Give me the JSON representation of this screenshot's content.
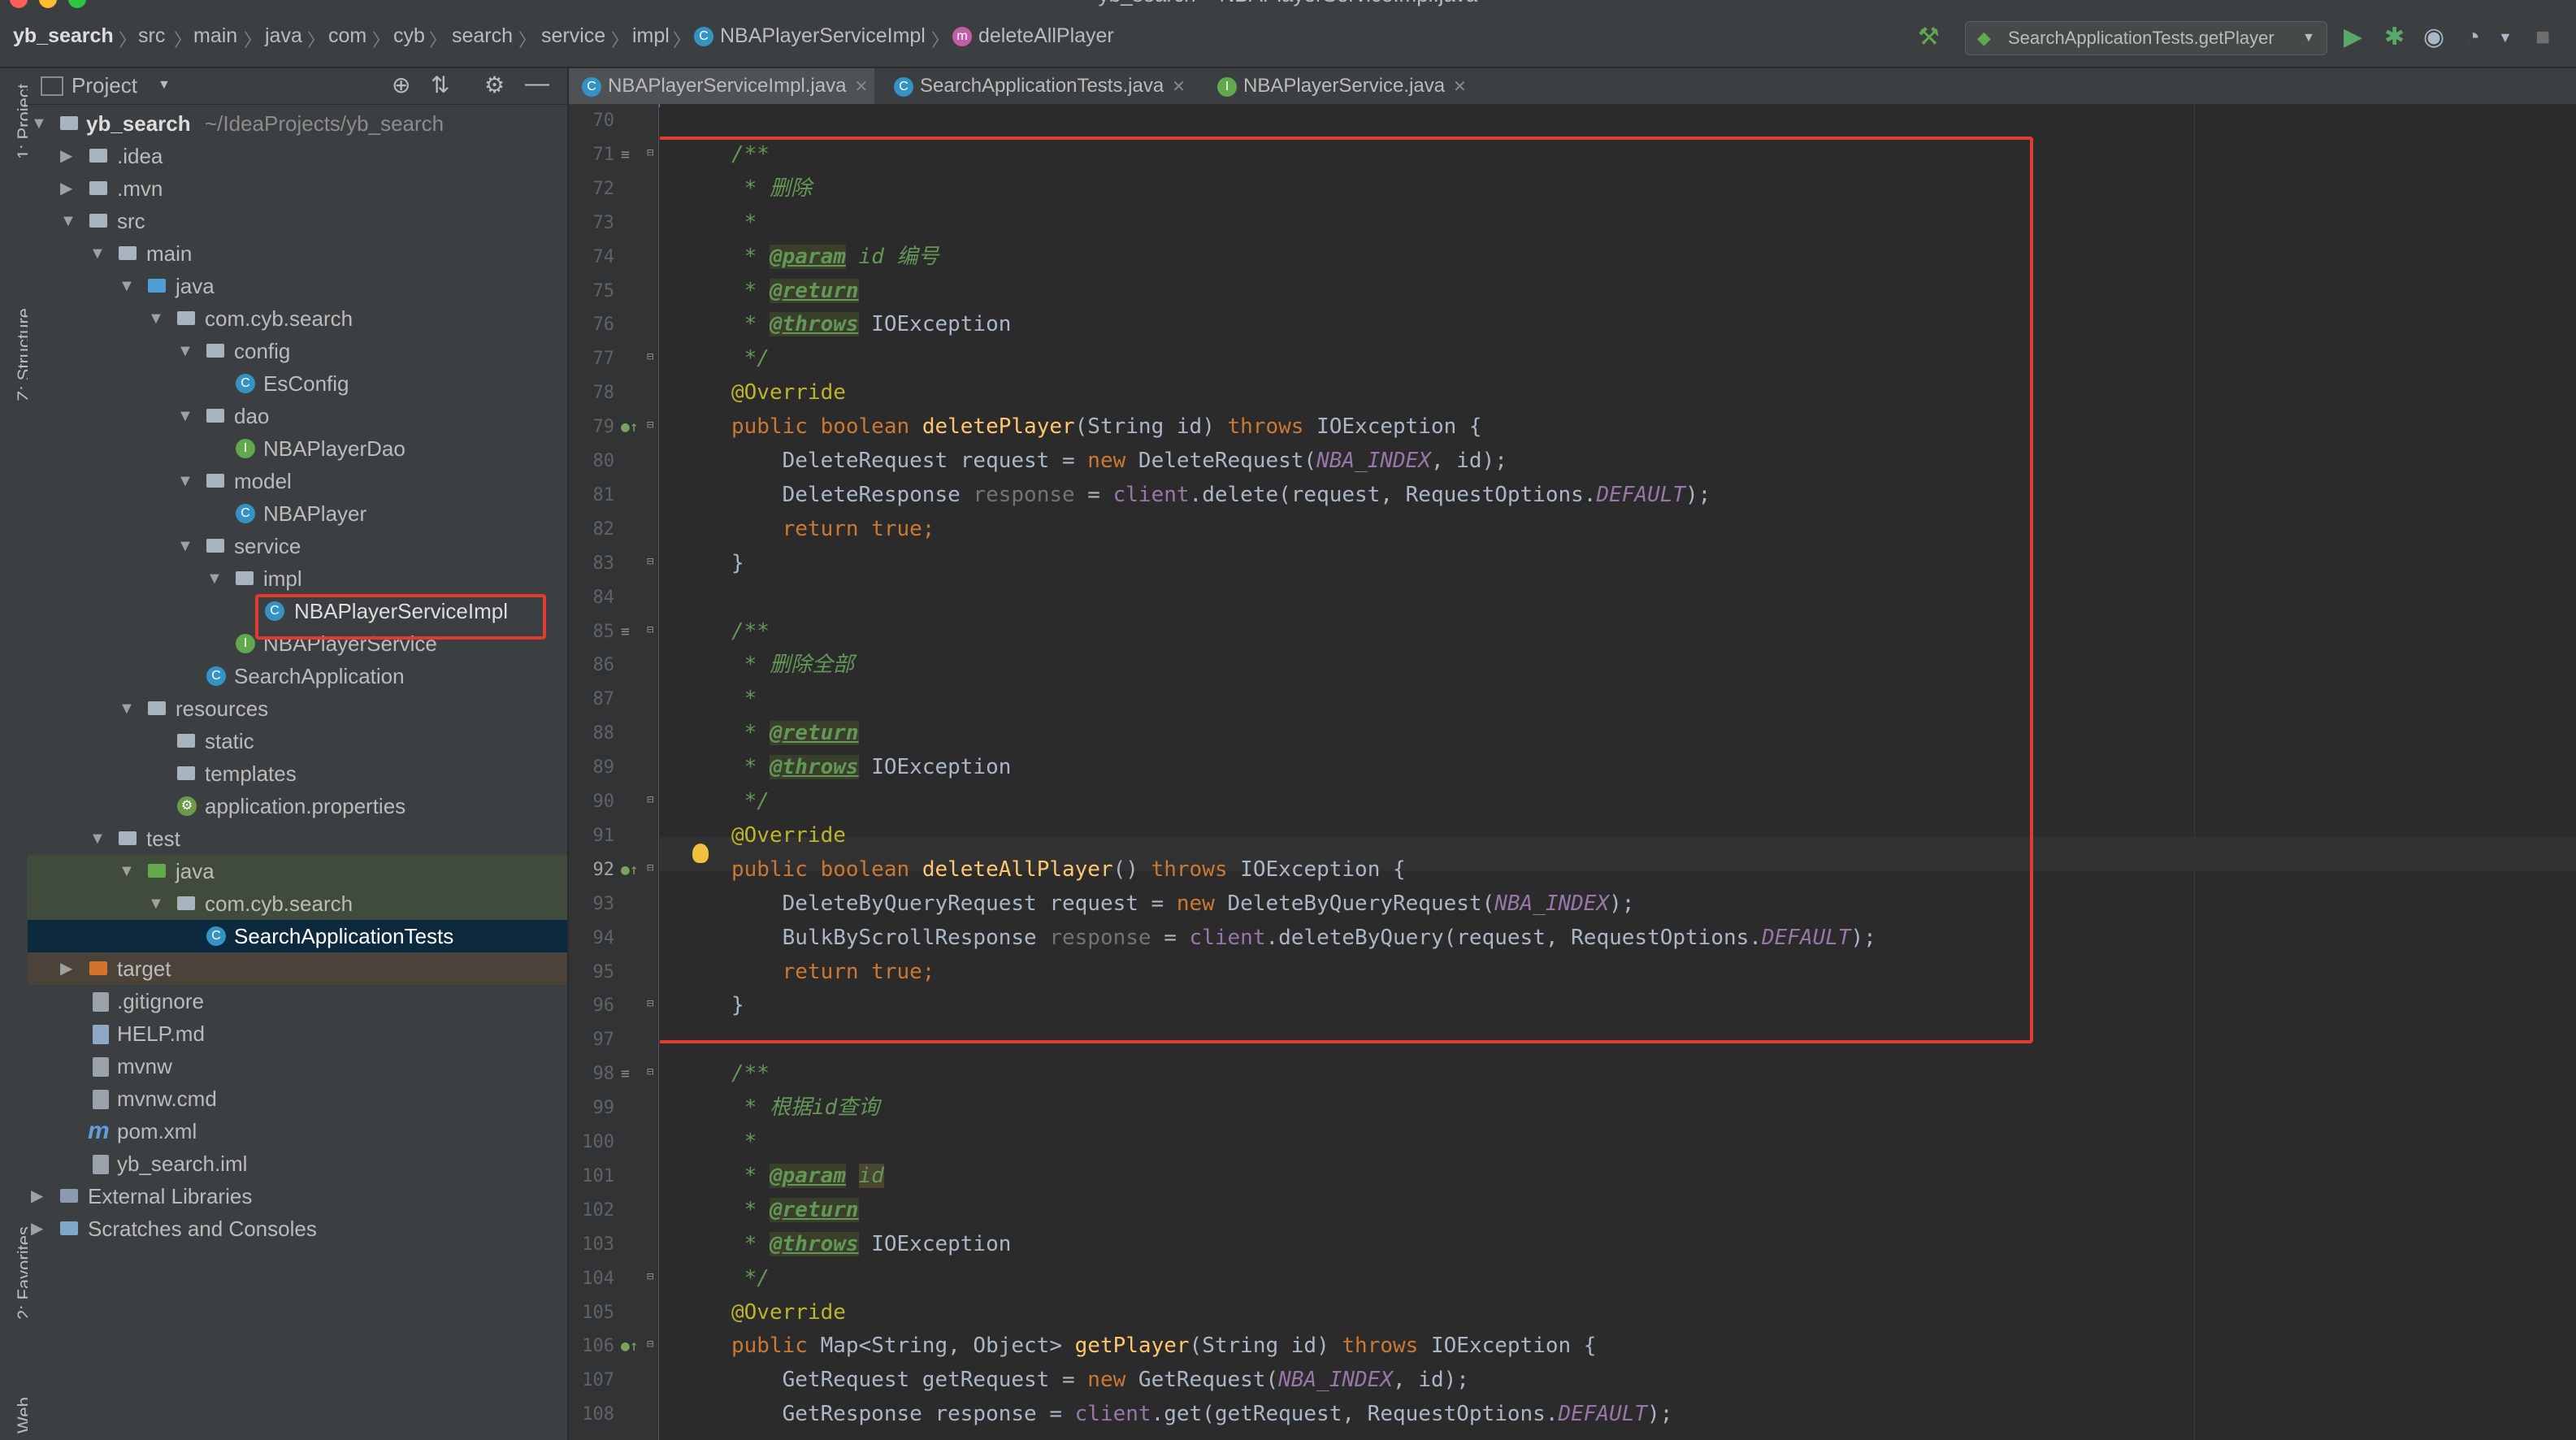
{
  "window_title": "yb_search – NBAPlayerServiceImpl.java",
  "navbar": {
    "project": "yb_search",
    "crumbs": [
      "src",
      "main",
      "java",
      "com",
      "cyb",
      "search",
      "service",
      "impl"
    ],
    "class_name": "NBAPlayerServiceImpl",
    "method_name": "deleteAllPlayer",
    "run_config": "SearchApplicationTests.getPlayer"
  },
  "sidebar_labels": {
    "project": "1: Project",
    "structure": "Z: Structure",
    "favorites": "2: Favorites",
    "web": "Web"
  },
  "project_panel": {
    "title": "Project",
    "tree": [
      {
        "label": "yb_search",
        "note": "~/IdeaProjects/yb_search"
      },
      {
        "label": ".idea"
      },
      {
        "label": ".mvn"
      },
      {
        "label": "src"
      },
      {
        "label": "main"
      },
      {
        "label": "java"
      },
      {
        "label": "com.cyb.search"
      },
      {
        "label": "config"
      },
      {
        "label": "EsConfig"
      },
      {
        "label": "dao"
      },
      {
        "label": "NBAPlayerDao"
      },
      {
        "label": "model"
      },
      {
        "label": "NBAPlayer"
      },
      {
        "label": "service"
      },
      {
        "label": "impl"
      },
      {
        "label": "NBAPlayerServiceImpl"
      },
      {
        "label": "NBAPlayerService"
      },
      {
        "label": "SearchApplication"
      },
      {
        "label": "resources"
      },
      {
        "label": "static"
      },
      {
        "label": "templates"
      },
      {
        "label": "application.properties"
      },
      {
        "label": "test"
      },
      {
        "label": "java"
      },
      {
        "label": "com.cyb.search"
      },
      {
        "label": "SearchApplicationTests"
      },
      {
        "label": "target"
      },
      {
        "label": ".gitignore"
      },
      {
        "label": "HELP.md"
      },
      {
        "label": "mvnw"
      },
      {
        "label": "mvnw.cmd"
      },
      {
        "label": "pom.xml"
      },
      {
        "label": "yb_search.iml"
      },
      {
        "label": "External Libraries"
      },
      {
        "label": "Scratches and Consoles"
      }
    ]
  },
  "tabs": [
    {
      "label": "NBAPlayerServiceImpl.java"
    },
    {
      "label": "SearchApplicationTests.java"
    },
    {
      "label": "NBAPlayerService.java"
    }
  ],
  "editor": {
    "current_line": "92",
    "lines": [
      {
        "n": "70"
      },
      {
        "n": "71",
        "parts": [
          {
            "t": "/**",
            "c": "cm"
          }
        ]
      },
      {
        "n": "72",
        "parts": [
          {
            "t": " * 删除",
            "c": "cm"
          }
        ]
      },
      {
        "n": "73",
        "parts": [
          {
            "t": " *",
            "c": "cm"
          }
        ]
      },
      {
        "n": "74",
        "parts": [
          {
            "t": " * ",
            "c": "cm"
          },
          {
            "t": "@param",
            "c": "tag"
          },
          {
            "t": " id 编号",
            "c": "cm"
          }
        ]
      },
      {
        "n": "75",
        "parts": [
          {
            "t": " * ",
            "c": "cm"
          },
          {
            "t": "@return",
            "c": "tag"
          }
        ]
      },
      {
        "n": "76",
        "parts": [
          {
            "t": " * ",
            "c": "cm"
          },
          {
            "t": "@throws",
            "c": "tag"
          },
          {
            "t": " IOException",
            "c": "plain"
          }
        ]
      },
      {
        "n": "77",
        "parts": [
          {
            "t": " */",
            "c": "cm"
          }
        ]
      },
      {
        "n": "78",
        "parts": [
          {
            "t": "@Override",
            "c": "ann"
          }
        ]
      },
      {
        "n": "79",
        "parts": [
          {
            "t": "public boolean ",
            "c": "kw"
          },
          {
            "t": "deletePlayer",
            "c": "fn"
          },
          {
            "t": "(String id) ",
            "c": "plain"
          },
          {
            "t": "throws ",
            "c": "kw"
          },
          {
            "t": "IOException {",
            "c": "plain"
          }
        ]
      },
      {
        "n": "80",
        "parts": [
          {
            "t": "    DeleteRequest request = ",
            "c": "plain"
          },
          {
            "t": "new ",
            "c": "kw"
          },
          {
            "t": "DeleteRequest(",
            "c": "plain"
          },
          {
            "t": "NBA_INDEX",
            "c": "cst"
          },
          {
            "t": ", id);",
            "c": "plain"
          }
        ]
      },
      {
        "n": "81",
        "parts": [
          {
            "t": "    DeleteResponse ",
            "c": "plain"
          },
          {
            "t": "response",
            "c": "unused"
          },
          {
            "t": " = ",
            "c": "plain"
          },
          {
            "t": "client",
            "c": "fld"
          },
          {
            "t": ".delete(request, RequestOptions.",
            "c": "plain"
          },
          {
            "t": "DEFAULT",
            "c": "cst"
          },
          {
            "t": ");",
            "c": "plain"
          }
        ]
      },
      {
        "n": "82",
        "parts": [
          {
            "t": "    return true;",
            "c": "kw"
          }
        ]
      },
      {
        "n": "83",
        "parts": [
          {
            "t": "}",
            "c": "plain"
          }
        ]
      },
      {
        "n": "84"
      },
      {
        "n": "85",
        "parts": [
          {
            "t": "/**",
            "c": "cm"
          }
        ]
      },
      {
        "n": "86",
        "parts": [
          {
            "t": " * 删除全部",
            "c": "cm"
          }
        ]
      },
      {
        "n": "87",
        "parts": [
          {
            "t": " *",
            "c": "cm"
          }
        ]
      },
      {
        "n": "88",
        "parts": [
          {
            "t": " * ",
            "c": "cm"
          },
          {
            "t": "@return",
            "c": "tag"
          }
        ]
      },
      {
        "n": "89",
        "parts": [
          {
            "t": " * ",
            "c": "cm"
          },
          {
            "t": "@throws",
            "c": "tag"
          },
          {
            "t": " IOException",
            "c": "plain"
          }
        ]
      },
      {
        "n": "90",
        "parts": [
          {
            "t": " */",
            "c": "cm"
          }
        ]
      },
      {
        "n": "91",
        "parts": [
          {
            "t": "@Override",
            "c": "ann"
          }
        ]
      },
      {
        "n": "92",
        "parts": [
          {
            "t": "public boolean ",
            "c": "kw"
          },
          {
            "t": "deleteAllPlayer",
            "c": "fn"
          },
          {
            "t": "() ",
            "c": "plain"
          },
          {
            "t": "throws ",
            "c": "kw"
          },
          {
            "t": "IOException {",
            "c": "plain"
          }
        ]
      },
      {
        "n": "93",
        "parts": [
          {
            "t": "    DeleteByQueryRequest request = ",
            "c": "plain"
          },
          {
            "t": "new ",
            "c": "kw"
          },
          {
            "t": "DeleteByQueryRequest(",
            "c": "plain"
          },
          {
            "t": "NBA_INDEX",
            "c": "cst"
          },
          {
            "t": ");",
            "c": "plain"
          }
        ]
      },
      {
        "n": "94",
        "parts": [
          {
            "t": "    BulkByScrollResponse ",
            "c": "plain"
          },
          {
            "t": "response",
            "c": "unused"
          },
          {
            "t": " = ",
            "c": "plain"
          },
          {
            "t": "client",
            "c": "fld"
          },
          {
            "t": ".deleteByQuery(request, RequestOptions.",
            "c": "plain"
          },
          {
            "t": "DEFAULT",
            "c": "cst"
          },
          {
            "t": ");",
            "c": "plain"
          }
        ]
      },
      {
        "n": "95",
        "parts": [
          {
            "t": "    return true;",
            "c": "kw"
          }
        ]
      },
      {
        "n": "96",
        "parts": [
          {
            "t": "}",
            "c": "plain"
          }
        ]
      },
      {
        "n": "97"
      },
      {
        "n": "98",
        "parts": [
          {
            "t": "/**",
            "c": "cm"
          }
        ]
      },
      {
        "n": "99",
        "parts": [
          {
            "t": " * 根据id查询",
            "c": "cm"
          }
        ]
      },
      {
        "n": "100",
        "parts": [
          {
            "t": " *",
            "c": "cm"
          }
        ]
      },
      {
        "n": "101",
        "parts": [
          {
            "t": " * ",
            "c": "cm"
          },
          {
            "t": "@param",
            "c": "tag"
          },
          {
            "t": " ",
            "c": "cm"
          },
          {
            "t": "id",
            "c": "idhl"
          }
        ]
      },
      {
        "n": "102",
        "parts": [
          {
            "t": " * ",
            "c": "cm"
          },
          {
            "t": "@return",
            "c": "tag"
          }
        ]
      },
      {
        "n": "103",
        "parts": [
          {
            "t": " * ",
            "c": "cm"
          },
          {
            "t": "@throws",
            "c": "tag"
          },
          {
            "t": " IOException",
            "c": "plain"
          }
        ]
      },
      {
        "n": "104",
        "parts": [
          {
            "t": " */",
            "c": "cm"
          }
        ]
      },
      {
        "n": "105",
        "parts": [
          {
            "t": "@Override",
            "c": "ann"
          }
        ]
      },
      {
        "n": "106",
        "parts": [
          {
            "t": "public ",
            "c": "kw"
          },
          {
            "t": "Map<String, Object> ",
            "c": "plain"
          },
          {
            "t": "getPlayer",
            "c": "fn"
          },
          {
            "t": "(String id) ",
            "c": "plain"
          },
          {
            "t": "throws ",
            "c": "kw"
          },
          {
            "t": "IOException {",
            "c": "plain"
          }
        ]
      },
      {
        "n": "107",
        "parts": [
          {
            "t": "    GetRequest getRequest = ",
            "c": "plain"
          },
          {
            "t": "new ",
            "c": "kw"
          },
          {
            "t": "GetRequest(",
            "c": "plain"
          },
          {
            "t": "NBA_INDEX",
            "c": "cst"
          },
          {
            "t": ", id);",
            "c": "plain"
          }
        ]
      },
      {
        "n": "108",
        "parts": [
          {
            "t": "    GetResponse response = ",
            "c": "plain"
          },
          {
            "t": "client",
            "c": "fld"
          },
          {
            "t": ".get(getRequest, RequestOptions.",
            "c": "plain"
          },
          {
            "t": "DEFAULT",
            "c": "cst"
          },
          {
            "t": ");",
            "c": "plain"
          }
        ]
      }
    ]
  }
}
